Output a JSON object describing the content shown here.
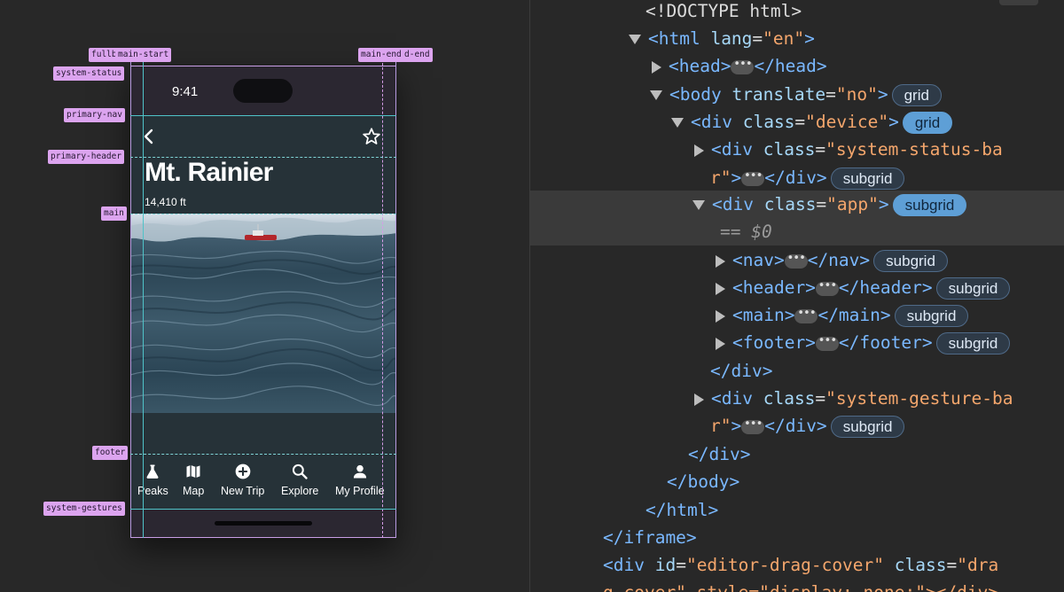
{
  "phone": {
    "status_time": "9:41",
    "title": "Mt. Rainier",
    "elevation": "14,410 ft",
    "tabs": [
      {
        "label": "Peaks",
        "icon": "flask-icon"
      },
      {
        "label": "Map",
        "icon": "map-icon"
      },
      {
        "label": "New Trip",
        "icon": "add-circle-icon"
      },
      {
        "label": "Explore",
        "icon": "search-icon"
      },
      {
        "label": "My Profile",
        "icon": "person-icon"
      }
    ]
  },
  "grid_labels": {
    "fullbleed_start": "fullb",
    "main_start": "main-start",
    "main_end": "main-end",
    "fullbleed_end": "d-end",
    "system_status": "system-status",
    "primary_nav": "primary-nav",
    "primary_header": "primary-header",
    "main": "main",
    "footer": "footer",
    "system_gestures": "system-gestures"
  },
  "devtools": {
    "doctype": "<!DOCTYPE html>",
    "html_open": "<html",
    "html_attr": "lang",
    "html_val": "\"en\"",
    "head": "<head>",
    "head_close": "</head>",
    "body_open": "<body",
    "body_attr": "translate",
    "body_val": "\"no\"",
    "div_open": "<div",
    "class_attr": "class",
    "device_val": "\"device\"",
    "status_val_1": "\"system-status-ba",
    "status_val_2": "r\"",
    "app_val": "\"app\"",
    "eq_sel": "== $0",
    "nav": "<nav>",
    "nav_close": "</nav>",
    "header": "<header>",
    "header_close": "</header>",
    "main": "<main>",
    "main_close": "</main>",
    "footer": "<footer>",
    "footer_close": "</footer>",
    "div_close": "</div>",
    "gesture_val_1": "\"system-gesture-ba",
    "gesture_val_2": "r\"",
    "body_close": "</body>",
    "html_close": "</html>",
    "iframe_close": "</iframe>",
    "drag_id_attr": "id",
    "drag_id_val": "\"editor-drag-cover\"",
    "drag_class_val": "\"dra",
    "drag_last": "g-cover\" style=\"display: none;\"></div>",
    "badge_grid": "grid",
    "badge_subgrid": "subgrid",
    "ellipsis": "•••"
  }
}
